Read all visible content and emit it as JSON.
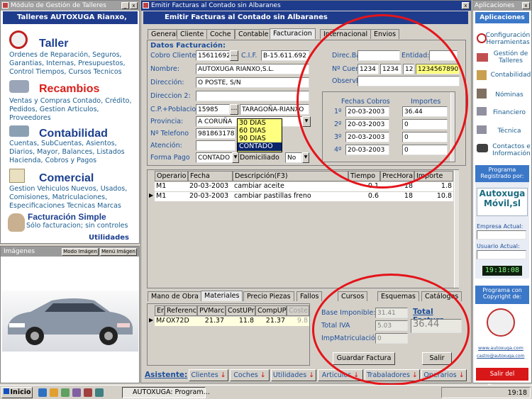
{
  "left_window": {
    "title": "Módulo de Gestión de Talleres",
    "header": "Talleres AUTOXUGA Rianxo,",
    "sections": [
      {
        "title": "Taller",
        "color": "#1b3f8f",
        "desc": "Ordenes de Reparación, Seguros, Garantias, Internas, Presupuestos, Control Tiempos, Cursos Tecnicos"
      },
      {
        "title": "Recambios",
        "color": "#d9201a",
        "desc": "Ventas y Compras Contado, Crédito, Pedidos, Gestion Articulos, Proveedores"
      },
      {
        "title": "Contabilidad",
        "color": "#1b3f8f",
        "desc": "Cuentas, SubCuentas, Asientos, Diarios, Mayor, Balances, Listados Hacienda, Cobros y Pagos"
      },
      {
        "title": "Comercial",
        "color": "#1b3f8f",
        "desc": "Gestion Vehiculos Nuevos, Usados, Comisiones, Matriculaciones, Especificaciones Tecnicas Marcas"
      }
    ],
    "simple_title": "Facturación Simple",
    "simple_desc": "Sólo facturacion; sin controles",
    "utilities": "Utilidades"
  },
  "images_window": {
    "title": "Imágenes",
    "mode_btn": "Modo Imágen",
    "menu_btn": "Menú Imágen"
  },
  "main_window": {
    "title": "Emitir Facturas al Contado sin Albaranes",
    "subtitle": "Emitir Facturas al Contado sin Albaranes",
    "tabs": [
      "General",
      "Cliente",
      "Coche",
      "Contable",
      "Facturacion",
      "Internacional",
      "Envios"
    ],
    "billing_header": "Datos Facturación:",
    "labels": {
      "cobro": "Cobro Cliente",
      "cif": "C.I.F.",
      "nombre": "Nombre:",
      "direccion": "Dirección:",
      "direccion2": "Direccion 2:",
      "cp": "C.P.+Poblacion",
      "provincia": "Provincia:",
      "telefono": "Nº Telefono",
      "atencion": "Atención:",
      "forma_pago": "Forma Pago",
      "domiciliado": "Domiciliado",
      "banco": "Direc.Banco:",
      "entidad": "Entidad:",
      "cuenta": "Nº Cuenta",
      "observ": "ObservBanco"
    },
    "values": {
      "cobro": "15611692",
      "cif": "B-15.611.692",
      "nombre": "AUTOXUGA RIANXO,S.L.",
      "direccion": "O POSTE, S/N",
      "cp": "15985",
      "poblacion": "TARAGOÑA-RIANXO",
      "provincia": "A CORUÑA",
      "telefono": "981863178",
      "forma_pago": "CONTADO",
      "domiciliado": "No",
      "cuenta1": "1234",
      "cuenta2": "1234",
      "cuenta3": "12",
      "cuenta4": "1234567890"
    },
    "dropdown": [
      "30 DIAS",
      "60 DIAS",
      "90 DIAS",
      "CONTADO"
    ],
    "payments": {
      "col1": "Fechas Cobros",
      "col2": "Importes",
      "rows": [
        {
          "n": "1º",
          "date": "20-03-2003",
          "amt": "36.44"
        },
        {
          "n": "2º",
          "date": "20-03-2003",
          "amt": "0"
        },
        {
          "n": "3º",
          "date": "20-03-2003",
          "amt": "0"
        },
        {
          "n": "4º",
          "date": "20-03-2003",
          "amt": "0"
        }
      ]
    },
    "ops": {
      "headers": [
        "Operario",
        "Fecha",
        "Descripción(F3)",
        "Tiempo",
        "PrecHora",
        "Importe"
      ],
      "rows": [
        [
          "M1",
          "20-03-2003",
          "cambiar aceite",
          "0.1",
          "18",
          "1.8"
        ],
        [
          "M1",
          "20-03-2003",
          "cambiar pastillas freno",
          "0.6",
          "18",
          "10.8"
        ]
      ]
    },
    "bottom_tabs": [
      "Mano de Obra",
      "Materiales",
      "Precio Piezas",
      "Fallos",
      "Cursos",
      "Esquemas",
      "Catálogos"
    ],
    "mat": {
      "headers": [
        "Em",
        "Referenc",
        "PVMarc",
        "CostUPre",
        "CompUPr",
        "Coste"
      ],
      "row": [
        "MA",
        "OX72D",
        "21.37",
        "11.8",
        "21.37",
        "9.8"
      ]
    },
    "totals": {
      "base_label": "Base Imponible:",
      "base": "31.41",
      "iva_label": "Total IVA",
      "iva": "5.03",
      "total_label": "Total Factura",
      "total": "36.44",
      "imp_label": "ImpMatriculació",
      "imp": "0"
    },
    "save_btn": "Guardar Factura",
    "exit_btn": "Salir",
    "assistant": "Asistente:",
    "assist_btns": [
      "Clientes",
      "Coches",
      "Utilidades",
      "Articulos",
      "Trabaladores",
      "Operarios"
    ]
  },
  "right_window": {
    "title": "Aplicaciones",
    "header": "Aplicaciones",
    "items": [
      "Configuración Herramientas",
      "Gestión de Talleres",
      "Contabilidad",
      "Nóminas",
      "Financiero",
      "Técnica",
      "Contactos e Información"
    ],
    "reg_title": "Programa Registrado por:",
    "brand1": "Autoxuga",
    "brand2": "Móvil,sl",
    "empresa": "Empresa Actual:",
    "usuario": "Usuario Actual:",
    "clock": "19:18:08",
    "copy_title": "Programa con Copyright de:",
    "site": "www.autoxuga.com",
    "mail": "castro@autoxuga.com",
    "exit": "Salir del Programa"
  },
  "taskbar": {
    "start": "Inicio",
    "app": "AUTOXUGA: Program...",
    "time": "19:18"
  }
}
